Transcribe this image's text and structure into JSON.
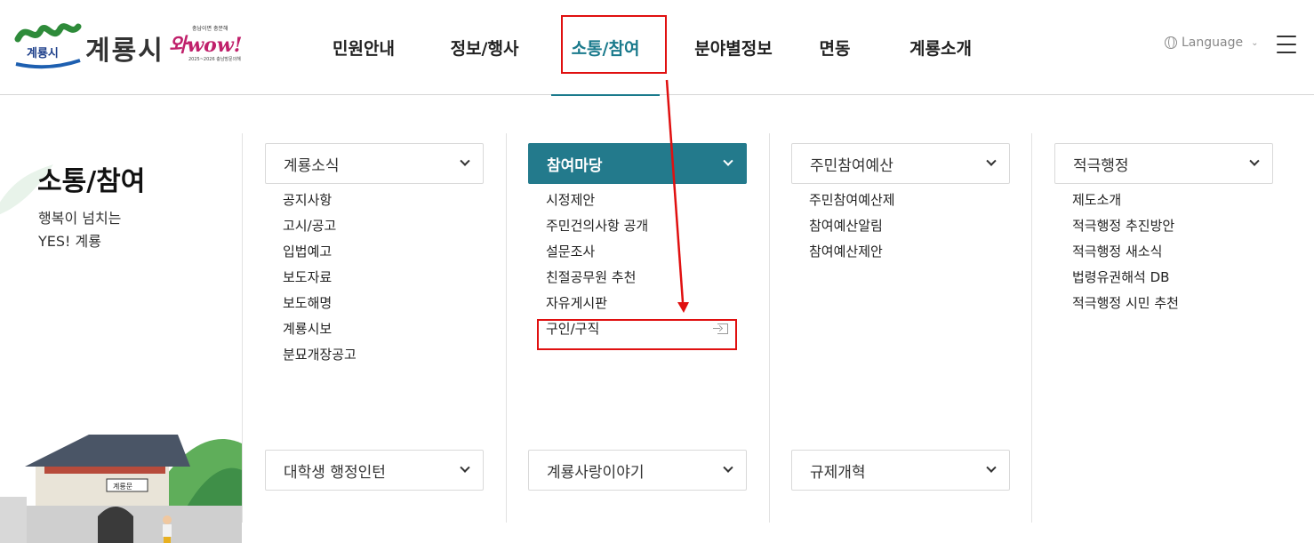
{
  "header": {
    "logo_text": "계룡시",
    "logo_mark_label": "계룡시",
    "slogan_top": "충남이면 충분해",
    "slogan_main": "와wow!",
    "slogan_bottom": "2025~2026 충남방문의해",
    "nav": [
      "민원안내",
      "정보/행사",
      "소통/참여",
      "분야별정보",
      "면동",
      "계룡소개"
    ],
    "active_nav": "소통/참여",
    "language_label": "Language"
  },
  "side": {
    "title": "소통/참여",
    "subtitle_line1": "행복이 넘치는",
    "subtitle_line2": "YES! 계룡",
    "gate_sign": "계룡문"
  },
  "columns": [
    {
      "header": "계룡소식",
      "links": [
        "공지사항",
        "고시/공고",
        "입법예고",
        "보도자료",
        "보도해명",
        "계룡시보",
        "분묘개장공고"
      ],
      "bottom": "대학생 행정인턴"
    },
    {
      "header": "참여마당",
      "links": [
        "시정제안",
        "주민건의사항 공개",
        "설문조사",
        "친절공무원 추천",
        "자유게시판",
        "구인/구직"
      ],
      "bottom": "계룡사랑이야기"
    },
    {
      "header": "주민참여예산",
      "links": [
        "주민참여예산제",
        "참여예산알림",
        "참여예산제안"
      ],
      "bottom": "규제개혁"
    },
    {
      "header": "적극행정",
      "links": [
        "제도소개",
        "적극행정 추진방안",
        "적극행정 새소식",
        "법령유권해석 DB",
        "적극행정 시민 추천"
      ]
    }
  ],
  "colors": {
    "accent": "#237a8c",
    "annotation_red": "#e01010",
    "border": "#d9d9d9"
  },
  "icons": {
    "lang": "globe-icon",
    "menu": "hamburger-icon",
    "accordion": "chevron-down-icon",
    "external": "new-window-icon"
  }
}
